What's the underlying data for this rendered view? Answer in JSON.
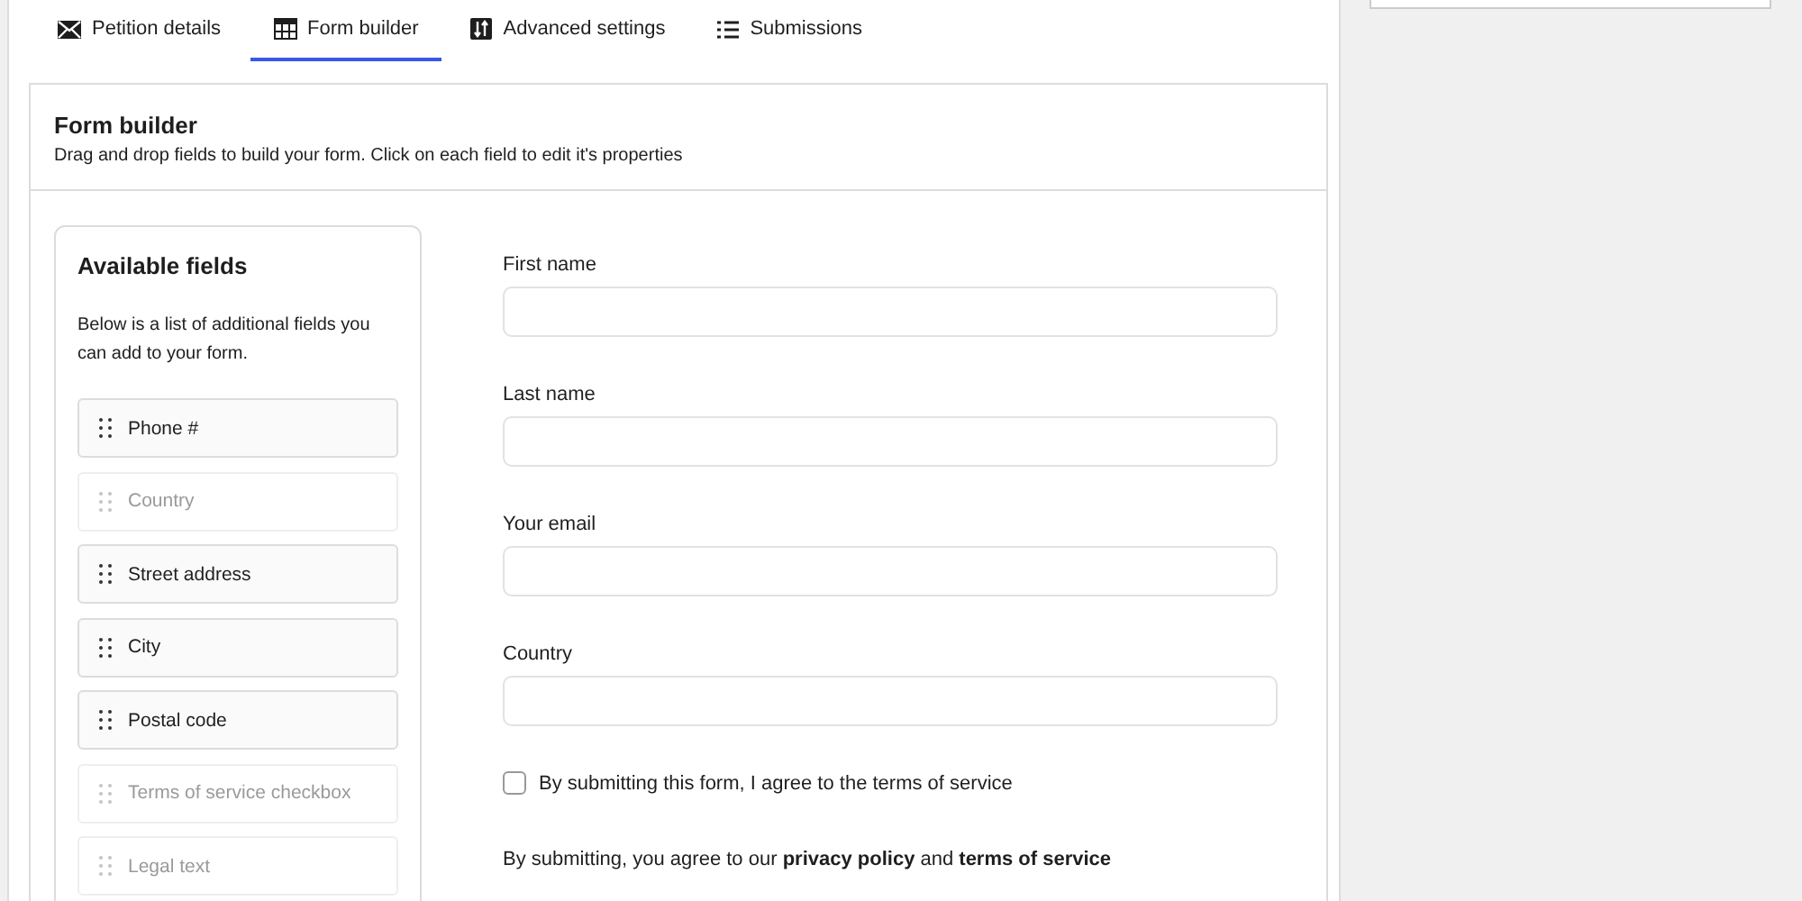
{
  "tabs": [
    {
      "label": "Petition details",
      "kind": "envelope",
      "selected": false
    },
    {
      "label": "Form builder",
      "kind": "grid",
      "selected": true
    },
    {
      "label": "Advanced settings",
      "kind": "sliders",
      "selected": false
    },
    {
      "label": "Submissions",
      "kind": "list",
      "selected": false
    }
  ],
  "panel": {
    "title": "Form builder",
    "description": "Drag and drop fields to build your form. Click on each field to edit it's properties"
  },
  "available_fields": {
    "title": "Available fields",
    "description": "Below is a list of additional fields you can add to your form.",
    "items": [
      {
        "label": "Phone #",
        "disabled": false
      },
      {
        "label": "Country",
        "disabled": true
      },
      {
        "label": "Street address",
        "disabled": false
      },
      {
        "label": "City",
        "disabled": false
      },
      {
        "label": "Postal code",
        "disabled": false
      },
      {
        "label": "Terms of service checkbox",
        "disabled": true
      },
      {
        "label": "Legal text",
        "disabled": true
      }
    ]
  },
  "form": {
    "fields": [
      {
        "kind": "text",
        "label": "First name"
      },
      {
        "kind": "text",
        "label": "Last name"
      },
      {
        "kind": "text",
        "label": "Your email"
      },
      {
        "kind": "text",
        "label": "Country"
      },
      {
        "kind": "checkbox",
        "label": "By submitting this form, I agree to the terms of service",
        "checked": false
      },
      {
        "kind": "legal",
        "text": "By submitting, you agree to our **privacy policy** and **terms of service**"
      }
    ]
  }
}
